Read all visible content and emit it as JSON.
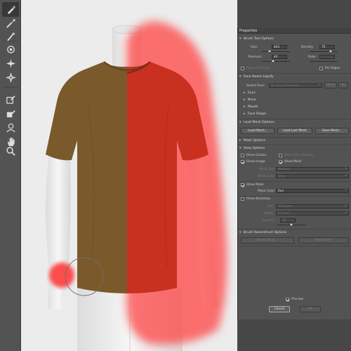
{
  "toolbar": {
    "tools": [
      "face-tool-icon",
      "forward-warp-icon",
      "reconstruct-icon",
      "smooth-icon",
      "twirl-icon",
      "pucker-icon",
      "bloat-icon",
      "push-left-icon",
      "freeze-mask-icon",
      "thaw-mask-icon",
      "face-icon",
      "hand-icon",
      "zoom-icon"
    ]
  },
  "panel": {
    "title": "Properties",
    "brush_tool_options": {
      "header": "Brush Tool Options",
      "size_label": "Size:",
      "size_value": "403",
      "density_label": "Density:",
      "density_value": "75",
      "pressure_label": "Pressure:",
      "pressure_value": "40",
      "rate_label": "Rate:",
      "rate_value": "",
      "stylus_label": "Stylus Pressure",
      "pin_edges_label": "Pin Edges"
    },
    "face_aware": {
      "header": "Face-Aware Liquify",
      "select_face_label": "Select Face:",
      "select_face_value": "No Faces Detected",
      "reset_label": "Reset",
      "all_label": "All",
      "eyes": "Eyes",
      "nose": "Nose",
      "mouth": "Mouth",
      "face_shape": "Face Shape"
    },
    "load_mesh": {
      "header": "Load Mesh Options",
      "load_mesh": "Load Mesh...",
      "load_last_mesh": "Load Last Mesh",
      "save_mesh": "Save Mesh..."
    },
    "mask_options": {
      "header": "Mask Options"
    },
    "view_options": {
      "header": "View Options",
      "show_guides": "Show Guides",
      "show_face_overlay": "Show Face Overlay",
      "show_image": "Show Image",
      "show_mesh": "Show Mesh",
      "mesh_size_label": "Mesh Size:",
      "mesh_size_value": "Medium",
      "mesh_color_label": "Mesh Color:",
      "mesh_color_value": "Gray",
      "show_mask": "Show Mask",
      "mask_color_label": "Mask Color:",
      "mask_color_value": "Red",
      "show_backdrop": "Show Backdrop",
      "use_label": "Use:",
      "use_value": "All Layers",
      "mode_label": "Mode:",
      "mode_value": "In Front",
      "opacity_label": "Opacity:",
      "opacity_value": "50"
    },
    "brush_reconstruct": {
      "header": "Brush Reconstruct Options",
      "reconstruct": "Reconstruct...",
      "restore_all": "Restore All"
    },
    "preview_label": "Preview",
    "cancel_label": "Cancel",
    "ok_label": "OK"
  },
  "colors": {
    "shirt": "#7a5a2b",
    "mask": "#ff3b3b",
    "panel_bg": "#535353"
  }
}
